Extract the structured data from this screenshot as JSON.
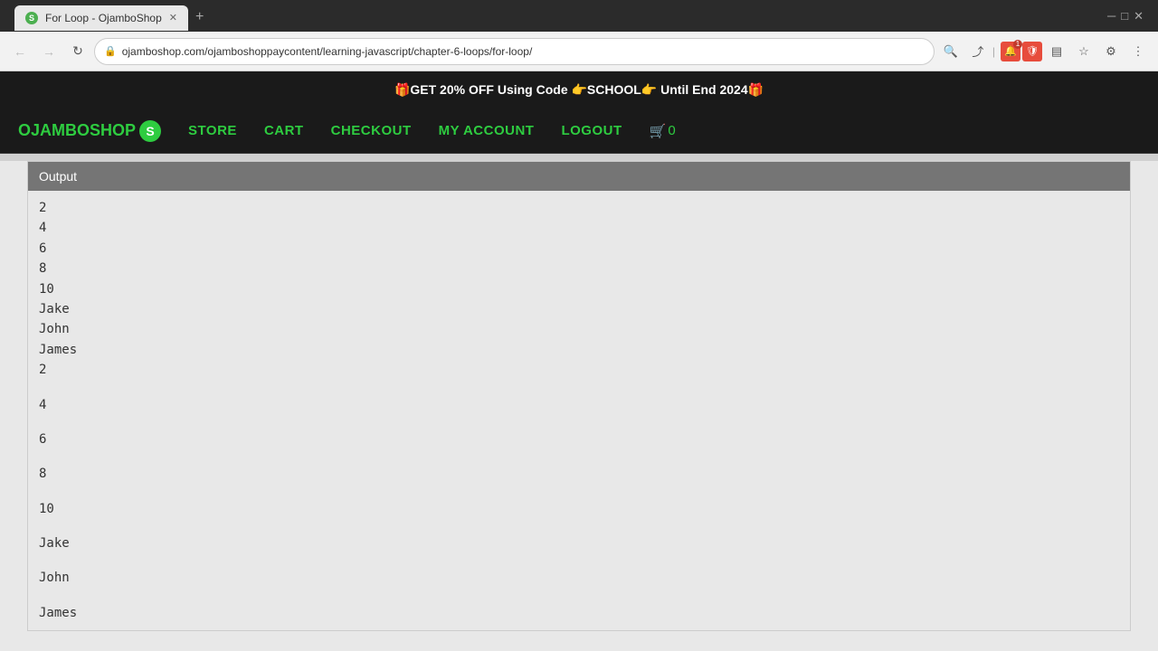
{
  "browser": {
    "tab_title": "For Loop - OjamboShop",
    "tab_favicon": "S",
    "new_tab_label": "+",
    "address": "ojamboshop.com/ojamboshoppaycontent/learning-javascript/chapter-6-loops/for-loop/",
    "back_btn": "←",
    "forward_btn": "→",
    "refresh_btn": "↻",
    "share_icon": "⤴",
    "rss_icon": ")",
    "bell_badge": "1",
    "window_controls": [
      "─",
      "□",
      "✕"
    ]
  },
  "promo_banner": {
    "text": "🎁GET 20% OFF Using Code 👉SCHOOL👉 Until End 2024🎁"
  },
  "nav": {
    "brand": "OJAMBOSHOP",
    "brand_icon": "S",
    "store": "STORE",
    "cart": "CART",
    "checkout": "CHECKOUT",
    "my_account": "MY ACCOUNT",
    "logout": "LOGOUT",
    "cart_icon": "🛒",
    "cart_count": "0"
  },
  "output_section": {
    "header": "Output",
    "lines_compact": [
      "2",
      "4",
      "6",
      "8",
      "10",
      "Jake",
      "John",
      "James",
      "2"
    ],
    "lines_spaced": [
      "4",
      "6",
      "8",
      "10",
      "Jake",
      "John",
      "James"
    ]
  }
}
